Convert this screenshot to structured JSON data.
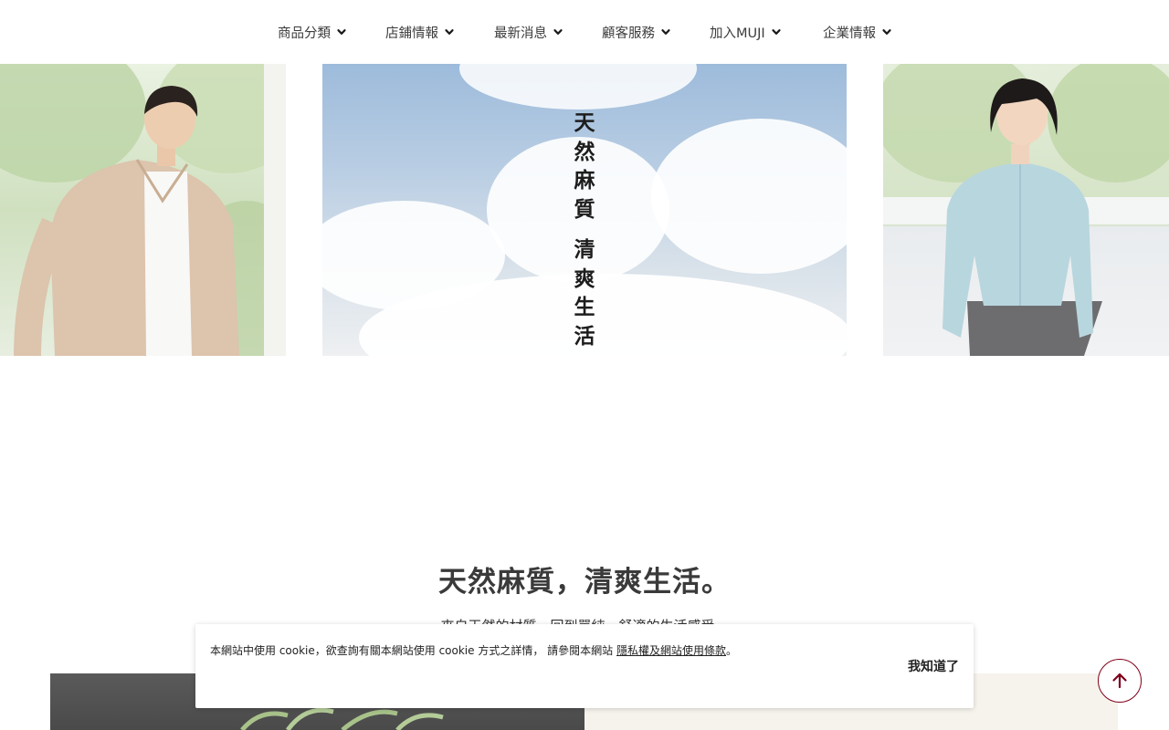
{
  "nav": {
    "items": [
      {
        "label": "商品分類"
      },
      {
        "label": "店鋪情報"
      },
      {
        "label": "最新消息"
      },
      {
        "label": "顧客服務"
      },
      {
        "label": "加入MUJI"
      },
      {
        "label": "企業情報"
      }
    ],
    "chevron_icon": "chevron-down-icon"
  },
  "hero": {
    "slides": [
      {
        "image": "man-in-beige-linen-shirt"
      },
      {
        "image": "sky-with-clouds",
        "vertical_text_1": [
          "天",
          "然",
          "麻",
          "質"
        ],
        "vertical_text_2": [
          "清",
          "爽",
          "生",
          "活"
        ]
      },
      {
        "image": "woman-in-light-blue-linen-shirt"
      }
    ]
  },
  "section": {
    "title": "天然麻質，清爽生活。",
    "subtitle": "來自天然的材質，回到單純，舒適的生活感受。"
  },
  "cookie": {
    "text": "本網站中使用 cookie，欲查詢有關本網站使用 cookie 方式之詳情， 請參閱本網站 ",
    "link": "隱私權及網站使用條款",
    "suffix": "。",
    "accept_label": "我知道了"
  },
  "back_to_top": {
    "icon": "arrow-up-icon"
  },
  "colors": {
    "accent": "#7f0019",
    "text": "#333333",
    "background": "#ffffff"
  }
}
